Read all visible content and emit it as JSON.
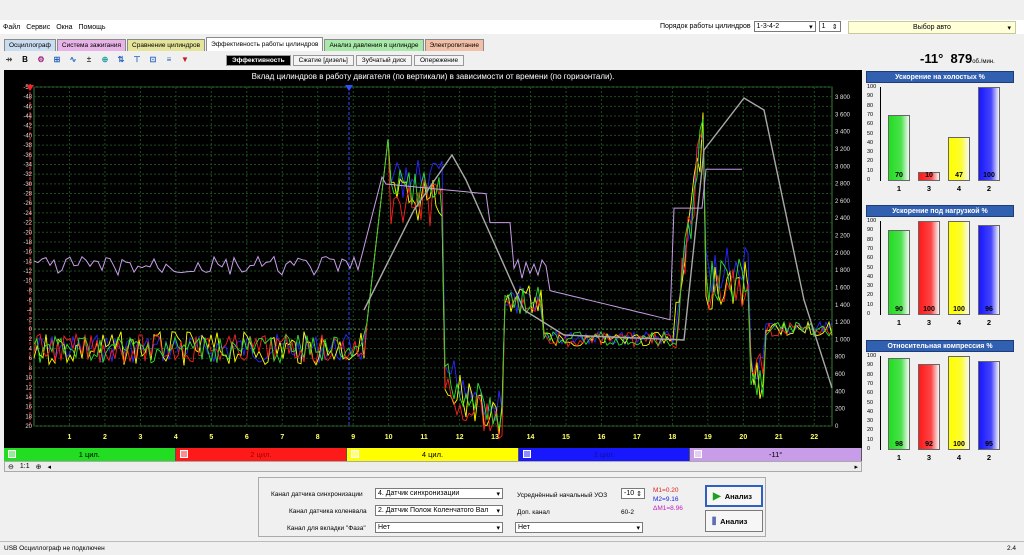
{
  "menu": [
    "Файл",
    "Сервис",
    "Окна",
    "Помощь"
  ],
  "order": {
    "label": "Порядок работы цилиндров",
    "value": "1-3-4-2",
    "stepper": "1"
  },
  "avto": "Выбор авто",
  "tabs": [
    {
      "label": "Осциллограф",
      "color": "#c9dcf0"
    },
    {
      "label": "Система зажигания",
      "color": "#e8b4e8"
    },
    {
      "label": "Сравнение цилиндров",
      "color": "#e4e49a"
    },
    {
      "label": "Эффективность работы цилиндров",
      "color": "#ffffff"
    },
    {
      "label": "Анализ давления в цилиндре",
      "color": "#a8e8a8"
    },
    {
      "label": "Электропитание",
      "color": "#f2c0a8"
    }
  ],
  "subtabs": [
    "Эффективность",
    "Сжатие [дизель]",
    "Зубчатый диск",
    "Опережение"
  ],
  "rpm": {
    "angle": "-11°",
    "value": "879",
    "unit": "об./мин."
  },
  "chart_data": {
    "type": "line",
    "title": "Вклад цилиндров в работу двигателя (по вертикали) в зависимости от времени (по горизонтали).",
    "y_left_ticks": [
      "-50",
      "-48",
      "-46",
      "-44",
      "-42",
      "-40",
      "-38",
      "-36",
      "-34",
      "-32",
      "-30",
      "-28",
      "-26",
      "-24",
      "-22",
      "-20",
      "-18",
      "-16",
      "-14",
      "-12",
      "-10",
      "-8",
      "-6",
      "-4",
      "-2",
      "0",
      "2",
      "4",
      "6",
      "8",
      "10",
      "12",
      "14",
      "16",
      "18",
      "20"
    ],
    "y_right_ticks": [
      "3 800",
      "3 600",
      "3 400",
      "3 200",
      "3 000",
      "2 800",
      "2 600",
      "2 400",
      "2 200",
      "2 000",
      "1 800",
      "1 600",
      "1 400",
      "1 200",
      "1 000",
      "800",
      "600",
      "400",
      "200",
      "0"
    ],
    "x_ticks": [
      "1",
      "2",
      "3",
      "4",
      "5",
      "6",
      "7",
      "8",
      "9",
      "10",
      "11",
      "12",
      "13",
      "14",
      "15",
      "16",
      "17",
      "18",
      "19",
      "20",
      "21",
      "22"
    ],
    "series": [
      {
        "name": "1 цил.",
        "color": "#2ee02e"
      },
      {
        "name": "2 цил.",
        "color": "#ff2020"
      },
      {
        "name": "4 цил.",
        "color": "#ffff00"
      },
      {
        "name": "3 цил.",
        "color": "#2828ff"
      },
      {
        "name": "-11°",
        "color": "#c89ce8"
      }
    ]
  },
  "legend": [
    {
      "label": "1 цил.",
      "bg": "#22dd22",
      "fg": "#000"
    },
    {
      "label": "2 цил.",
      "bg": "#ff1a1a",
      "fg": "#aa0000"
    },
    {
      "label": "4 цил.",
      "bg": "#ffff00",
      "fg": "#000"
    },
    {
      "label": "3 цил.",
      "bg": "#1818ff",
      "fg": "#1010a0"
    },
    {
      "label": "-11°",
      "bg": "#c89ce8",
      "fg": "#000"
    }
  ],
  "zoom": "1:1",
  "panels": [
    {
      "title": "Ускорение на холостых %",
      "bars": [
        {
          "label": "1",
          "value": 70,
          "color": "#22dd22"
        },
        {
          "label": "3",
          "value": 10,
          "color": "#ff1a1a"
        },
        {
          "label": "4",
          "value": 47,
          "color": "#ffff00"
        },
        {
          "label": "2",
          "value": 100,
          "color": "#1818ff"
        }
      ]
    },
    {
      "title": "Ускорение под нагрузкой %",
      "bars": [
        {
          "label": "1",
          "value": 90,
          "color": "#22dd22"
        },
        {
          "label": "3",
          "value": 100,
          "color": "#ff1a1a"
        },
        {
          "label": "4",
          "value": 100,
          "color": "#ffff00"
        },
        {
          "label": "2",
          "value": 96,
          "color": "#1818ff"
        }
      ]
    },
    {
      "title": "Относительная компрессия %",
      "bars": [
        {
          "label": "1",
          "value": 98,
          "color": "#22dd22"
        },
        {
          "label": "3",
          "value": 92,
          "color": "#ff1a1a"
        },
        {
          "label": "4",
          "value": 100,
          "color": "#ffff00"
        },
        {
          "label": "2",
          "value": 95,
          "color": "#1818ff"
        }
      ]
    }
  ],
  "panel_ticks": [
    "100",
    "90",
    "80",
    "70",
    "60",
    "50",
    "40",
    "30",
    "20",
    "10",
    "0"
  ],
  "bottom": {
    "sync_label": "Канал датчика синхронизации",
    "sync_value": "4. Датчик синхронизации",
    "crank_label": "Канал датчика коленвала",
    "crank_value": "2. Датчик Полож Коленчатого Вал",
    "phase_label": "Канал для вкладки \"Фаза\"",
    "phase_value": "Нет",
    "uoz_label": "Усреднённый начальный УОЗ",
    "uoz_value": "-10",
    "dop_label": "Доп. канал",
    "dop_code": "60-2",
    "dop_value": "Нет",
    "m1": "M1=0.20",
    "m2": "M2=9.16",
    "dm": "ΔM1=8.96",
    "analyze": "Анализ"
  },
  "status": {
    "left": "USB Осциллограф не подключен",
    "right": "2.4"
  }
}
